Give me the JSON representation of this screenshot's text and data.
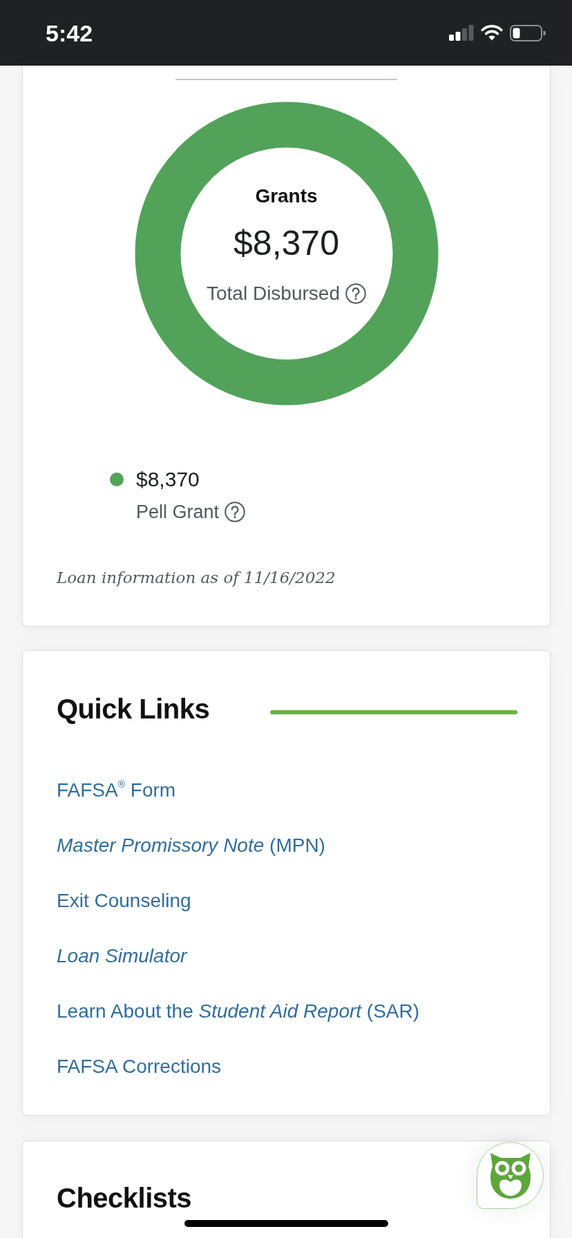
{
  "status_bar": {
    "time": "5:42"
  },
  "grants_card": {
    "chart": {
      "title": "Grants",
      "total": "$8,370",
      "total_label": "Total Disbursed"
    },
    "legend": [
      {
        "amount": "$8,370",
        "label": "Pell Grant",
        "color": "#52a25a"
      }
    ],
    "note": "Loan information as of 11/16/2022"
  },
  "quick_links": {
    "title": "Quick Links",
    "links": [
      {
        "text": "FAFSA$^{®}$ Form",
        "italic": false
      },
      {
        "text": "*Master Promissory Note* (MPN)",
        "italic": false
      },
      {
        "text": "Exit Counseling",
        "italic": false
      },
      {
        "text": "Loan Simulator",
        "italic": true
      },
      {
        "text": "Learn About the *Student Aid Report* (SAR)",
        "italic": false
      },
      {
        "text": "FAFSA Corrections",
        "italic": false
      }
    ]
  },
  "checklists": {
    "title": "Checklists"
  }
}
